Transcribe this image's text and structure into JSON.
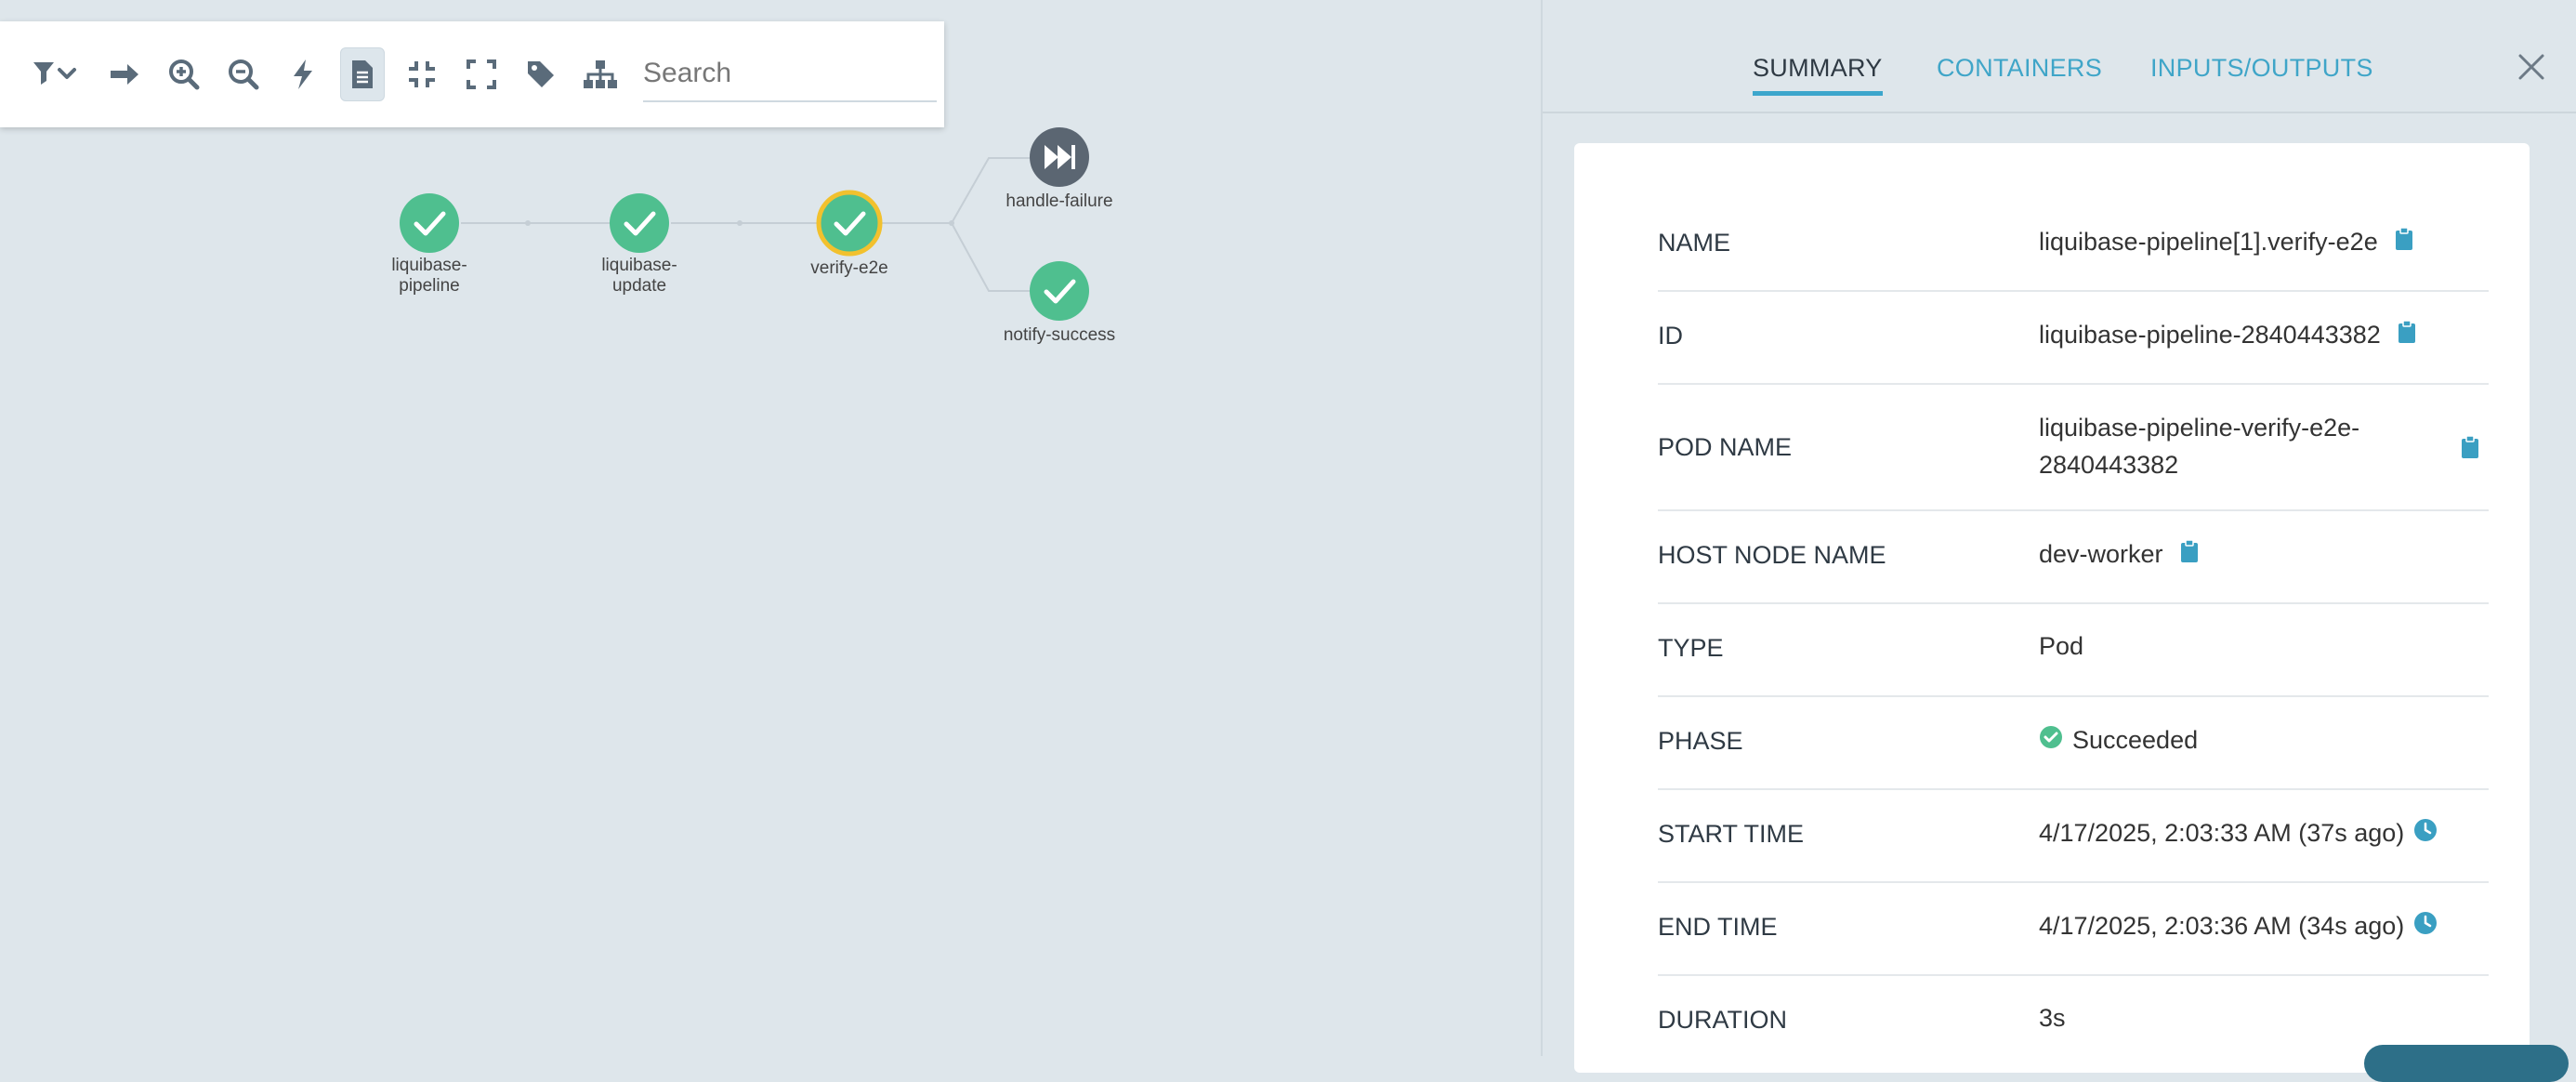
{
  "toolbar": {
    "search_placeholder": "Search",
    "icons": [
      "filter-dropdown-icon",
      "arrow-right-icon",
      "zoom-in-icon",
      "zoom-out-icon",
      "bolt-icon",
      "document-icon",
      "compress-icon",
      "expand-icon",
      "tag-icon",
      "sitemap-icon"
    ]
  },
  "graph": {
    "nodes": [
      {
        "id": "liquibase-pipeline",
        "label_line1": "liquibase-",
        "label_line2": "pipeline",
        "status": "succeeded"
      },
      {
        "id": "liquibase-update",
        "label_line1": "liquibase-",
        "label_line2": "update",
        "status": "succeeded"
      },
      {
        "id": "verify-e2e",
        "label_line1": "verify-e2e",
        "label_line2": "",
        "status": "succeeded",
        "selected": true
      },
      {
        "id": "handle-failure",
        "label_line1": "handle-failure",
        "label_line2": "",
        "status": "skipped"
      },
      {
        "id": "notify-success",
        "label_line1": "notify-success",
        "label_line2": "",
        "status": "succeeded"
      }
    ],
    "colors": {
      "success": "#4fbf8f",
      "skipped": "#5b6672",
      "selected_ring": "#f2c12e",
      "edge": "#c5ced5"
    }
  },
  "panel": {
    "tabs": [
      {
        "label": "SUMMARY",
        "active": true
      },
      {
        "label": "CONTAINERS",
        "active": false
      },
      {
        "label": "INPUTS/OUTPUTS",
        "active": false
      }
    ],
    "rows": [
      {
        "key": "NAME",
        "value": "liquibase-pipeline[1].verify-e2e",
        "copy": true
      },
      {
        "key": "ID",
        "value": "liquibase-pipeline-2840443382",
        "copy": true
      },
      {
        "key": "POD NAME",
        "value_line1": "liquibase-pipeline-verify-e2e-",
        "value_line2": "2840443382",
        "copy": true
      },
      {
        "key": "HOST NODE NAME",
        "value": "dev-worker",
        "copy": true
      },
      {
        "key": "TYPE",
        "value": "Pod"
      },
      {
        "key": "PHASE",
        "value": "Succeeded"
      },
      {
        "key": "START TIME",
        "value": "4/17/2025, 2:03:33 AM (37s ago)"
      },
      {
        "key": "END TIME",
        "value": "4/17/2025, 2:03:36 AM (34s ago)"
      },
      {
        "key": "DURATION",
        "value": "3s"
      }
    ],
    "colors": {
      "accent": "#3fa5c8",
      "copy_icon": "#3a9fc2"
    }
  }
}
